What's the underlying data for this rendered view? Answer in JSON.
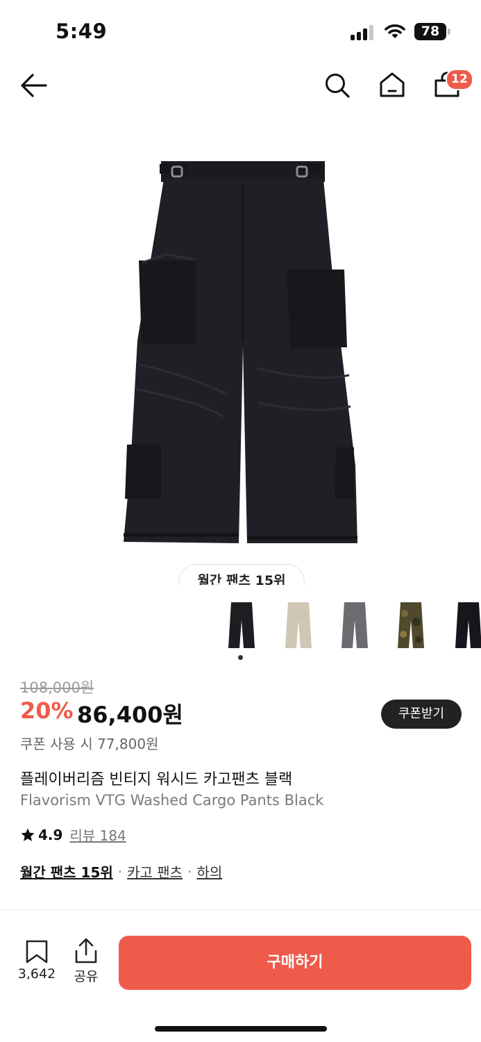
{
  "status_bar": {
    "time": "5:49",
    "battery": "78",
    "icons": [
      "signal-icon",
      "wifi-icon",
      "battery-icon"
    ]
  },
  "nav": {
    "icons": [
      "back-arrow-icon",
      "search-icon",
      "home-icon",
      "cart-icon"
    ],
    "cart_badge": "12"
  },
  "hero": {
    "rank_chip": "월간 팬츠 15위",
    "image": "black cargo pants product photo"
  },
  "thumbnails": [
    {
      "color": "#1d1d22"
    },
    {
      "color": "#cfc6b4"
    },
    {
      "color": "#6d6a70"
    },
    {
      "color": "#4f4a2c"
    },
    {
      "color": "#15171d"
    }
  ],
  "price": {
    "original": "108,000원",
    "discount": "20%",
    "sale": "86,400원",
    "coupon_button": "쿠폰받기",
    "coupon_price": "쿠폰 사용 시 77,800원"
  },
  "product": {
    "title_ko": "플레이버리즘 빈티지 워시드 카고팬츠 블랙",
    "title_en": "Flavorism VTG Washed Cargo Pants Black",
    "rating": "4.9",
    "reviews": "리뷰 184"
  },
  "categories": {
    "rank": "월간 팬츠 15위",
    "sub": "카고 팬츠",
    "main": "하의"
  },
  "bottom_bar": {
    "bookmark_count": "3,642",
    "share_label": "공유",
    "buy_button": "구매하기"
  },
  "colors": {
    "accent": "#ef5b4b",
    "dark": "#222222"
  }
}
